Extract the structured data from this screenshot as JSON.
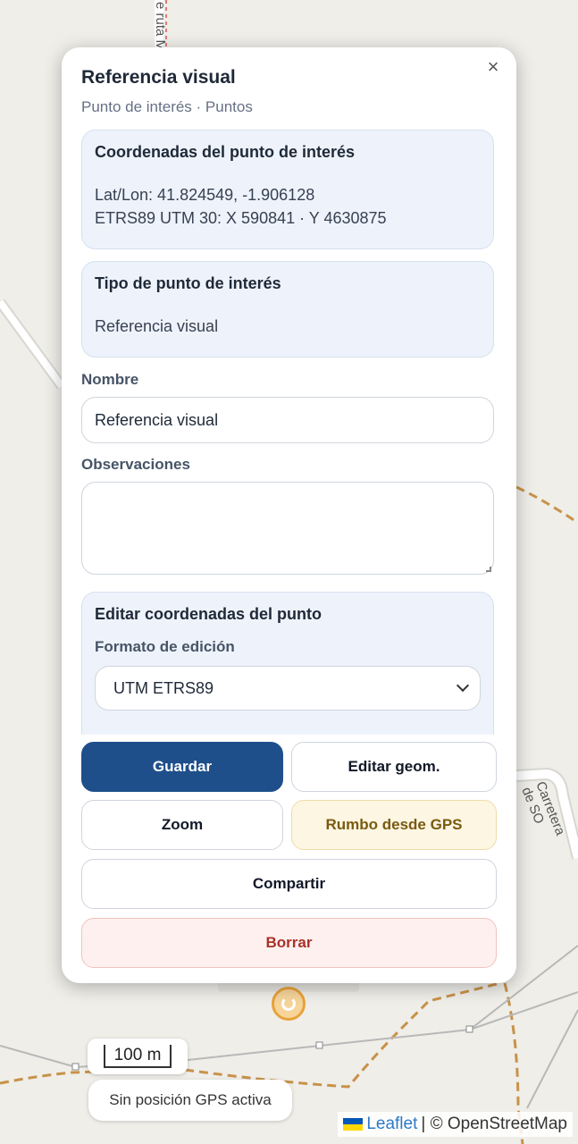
{
  "map": {
    "road_top": "e ruta M",
    "road_right": "Carretera de SO",
    "scale_label": "100 m",
    "gps_status": "Sin posición GPS activa",
    "attribution_link": "Leaflet",
    "attribution_text": "| © OpenStreetMap"
  },
  "popup": {
    "close": "×",
    "title": "Referencia visual",
    "subtitle": "Punto de interés · Puntos",
    "coords_panel": {
      "heading": "Coordenadas del punto de interés",
      "latlon": "Lat/Lon: 41.824549, -1.906128",
      "utm": "ETRS89 UTM 30: X 590841 · Y 4630875"
    },
    "type_panel": {
      "heading": "Tipo de punto de interés",
      "value": "Referencia visual"
    },
    "name_label": "Nombre",
    "name_value": "Referencia visual",
    "obs_label": "Observaciones",
    "obs_value": "",
    "edit_panel": {
      "heading": "Editar coordenadas del punto",
      "format_label": "Formato de edición",
      "format_value": "UTM ETRS89"
    },
    "buttons": {
      "save": "Guardar",
      "edit_geom": "Editar geom.",
      "zoom": "Zoom",
      "heading_gps": "Rumbo desde GPS",
      "share": "Compartir",
      "delete": "Borrar"
    }
  },
  "colors": {
    "primary": "#1e4f8a",
    "gps_bg": "#fdf6e3",
    "delete_text": "#a83228",
    "track": "#c8924a"
  }
}
